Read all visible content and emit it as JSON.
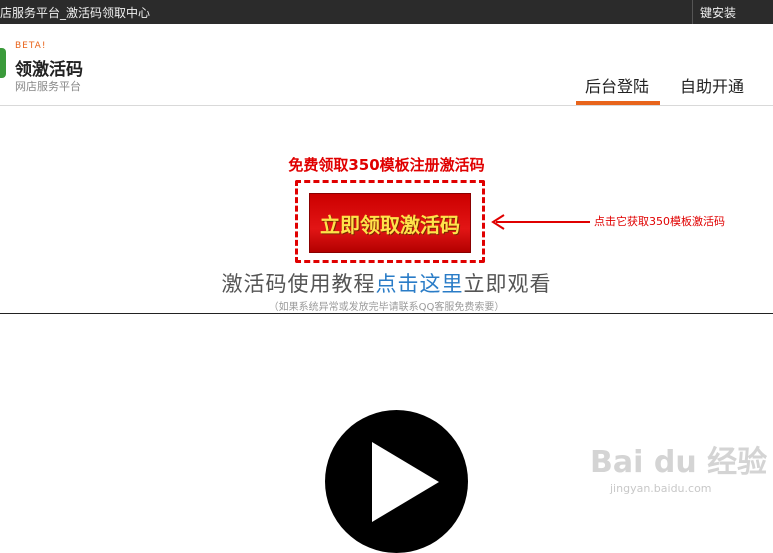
{
  "topbar": {
    "title": "店服务平台_激活码领取中心",
    "right": "键安装"
  },
  "header": {
    "beta": "BETA!",
    "logo_title": "领激活码",
    "logo_sub": "网店服务平台",
    "tabs": [
      {
        "label": "后台登陆",
        "active": true
      },
      {
        "label": "自助开通",
        "active": false
      }
    ],
    "accent": "#e8641b"
  },
  "promo": {
    "title": "免费领取350模板注册激活码",
    "button_label": "立即领取激活码",
    "arrow_label": "点击它获取350模板激活码",
    "tutorial_pre": "激活码使用教程",
    "tutorial_link": "点击这里",
    "tutorial_post": "立即观看",
    "note": "（如果系统异常或发放完毕请联系QQ客服免费索要）",
    "accent": "#e00000"
  },
  "watermark": {
    "big": "Bai du 经验",
    "small": "jingyan.baidu.com"
  }
}
